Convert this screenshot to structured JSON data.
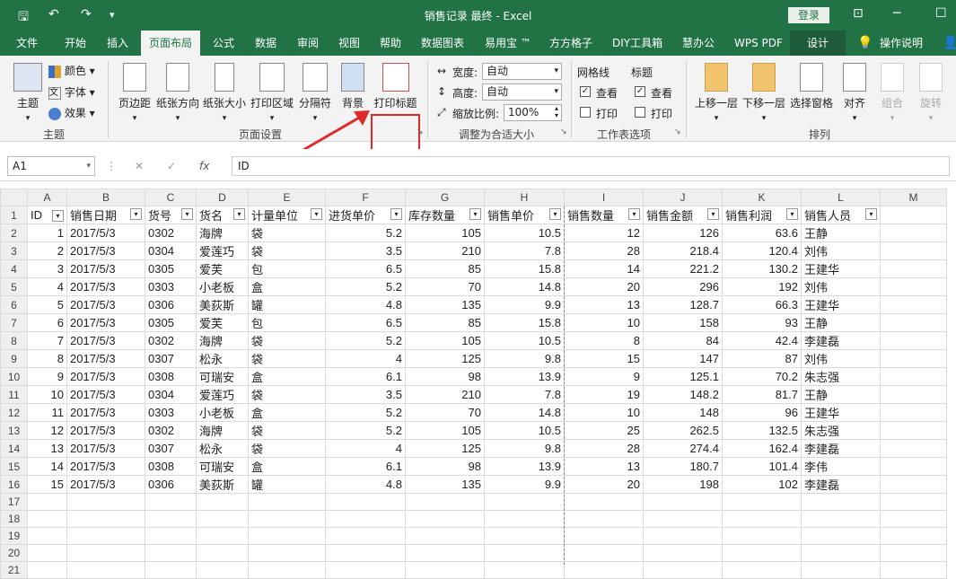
{
  "window": {
    "title": "销售记录 最终  -  Excel",
    "login": "登录"
  },
  "tabs": [
    "文件",
    "开始",
    "插入",
    "页面布局",
    "公式",
    "数据",
    "审阅",
    "视图",
    "帮助",
    "数据图表",
    "易用宝 ™",
    "方方格子",
    "DIY工具箱",
    "慧办公",
    "WPS PDF",
    "设计",
    "操作说明"
  ],
  "ribbon": {
    "theme": {
      "themes": "主题",
      "colors": "颜色",
      "fonts": "字体",
      "effects": "效果",
      "group": "主题"
    },
    "pagesetup": {
      "margins": "页边距",
      "orientation": "纸张方向",
      "size": "纸张大小",
      "printarea": "打印区域",
      "breaks": "分隔符",
      "background": "背景",
      "printtitles": "打印标题",
      "group": "页面设置"
    },
    "scale": {
      "width_label": "宽度:",
      "width_val": "自动",
      "height_label": "高度:",
      "height_val": "自动",
      "scale_label": "缩放比例:",
      "scale_val": "100%",
      "group": "调整为合适大小"
    },
    "sheet": {
      "gridlines": "网格线",
      "headings": "标题",
      "view": "查看",
      "print": "打印",
      "group": "工作表选项"
    },
    "arrange": {
      "forward": "上移一层",
      "backward": "下移一层",
      "pane": "选择窗格",
      "align": "对齐",
      "group_btn": "组合",
      "rotate": "旋转",
      "group": "排列"
    }
  },
  "formula": {
    "namebox": "A1",
    "content": "ID"
  },
  "cols": [
    "A",
    "B",
    "C",
    "D",
    "E",
    "F",
    "G",
    "H",
    "I",
    "J",
    "K",
    "L",
    "M"
  ],
  "headers": [
    "ID",
    "销售日期",
    "货号",
    "货名",
    "计量单位",
    "进货单价",
    "库存数量",
    "销售单价",
    "销售数量",
    "销售金额",
    "销售利润",
    "销售人员"
  ],
  "rows": [
    [
      "1",
      "2017/5/3",
      "0302",
      "海牌",
      "袋",
      "5.2",
      "105",
      "10.5",
      "12",
      "126",
      "63.6",
      "王静"
    ],
    [
      "2",
      "2017/5/3",
      "0304",
      "爱莲巧",
      "袋",
      "3.5",
      "210",
      "7.8",
      "28",
      "218.4",
      "120.4",
      "刘伟"
    ],
    [
      "3",
      "2017/5/3",
      "0305",
      "爱芙",
      "包",
      "6.5",
      "85",
      "15.8",
      "14",
      "221.2",
      "130.2",
      "王建华"
    ],
    [
      "4",
      "2017/5/3",
      "0303",
      "小老板",
      "盒",
      "5.2",
      "70",
      "14.8",
      "20",
      "296",
      "192",
      "刘伟"
    ],
    [
      "5",
      "2017/5/3",
      "0306",
      "美荻斯",
      "罐",
      "4.8",
      "135",
      "9.9",
      "13",
      "128.7",
      "66.3",
      "王建华"
    ],
    [
      "6",
      "2017/5/3",
      "0305",
      "爱芙",
      "包",
      "6.5",
      "85",
      "15.8",
      "10",
      "158",
      "93",
      "王静"
    ],
    [
      "7",
      "2017/5/3",
      "0302",
      "海牌",
      "袋",
      "5.2",
      "105",
      "10.5",
      "8",
      "84",
      "42.4",
      "李建磊"
    ],
    [
      "8",
      "2017/5/3",
      "0307",
      "松永",
      "袋",
      "4",
      "125",
      "9.8",
      "15",
      "147",
      "87",
      "刘伟"
    ],
    [
      "9",
      "2017/5/3",
      "0308",
      "可瑞安",
      "盒",
      "6.1",
      "98",
      "13.9",
      "9",
      "125.1",
      "70.2",
      "朱志强"
    ],
    [
      "10",
      "2017/5/3",
      "0304",
      "爱莲巧",
      "袋",
      "3.5",
      "210",
      "7.8",
      "19",
      "148.2",
      "81.7",
      "王静"
    ],
    [
      "11",
      "2017/5/3",
      "0303",
      "小老板",
      "盒",
      "5.2",
      "70",
      "14.8",
      "10",
      "148",
      "96",
      "王建华"
    ],
    [
      "12",
      "2017/5/3",
      "0302",
      "海牌",
      "袋",
      "5.2",
      "105",
      "10.5",
      "25",
      "262.5",
      "132.5",
      "朱志强"
    ],
    [
      "13",
      "2017/5/3",
      "0307",
      "松永",
      "袋",
      "4",
      "125",
      "9.8",
      "28",
      "274.4",
      "162.4",
      "李建磊"
    ],
    [
      "14",
      "2017/5/3",
      "0308",
      "可瑞安",
      "盒",
      "6.1",
      "98",
      "13.9",
      "13",
      "180.7",
      "101.4",
      "李伟"
    ],
    [
      "15",
      "2017/5/3",
      "0306",
      "美荻斯",
      "罐",
      "4.8",
      "135",
      "9.9",
      "20",
      "198",
      "102",
      "李建磊"
    ]
  ],
  "empty_rows": [
    "17",
    "18",
    "19",
    "20",
    "21"
  ],
  "colors": {
    "brand": "#217346",
    "highlight": "#e02a2a"
  }
}
